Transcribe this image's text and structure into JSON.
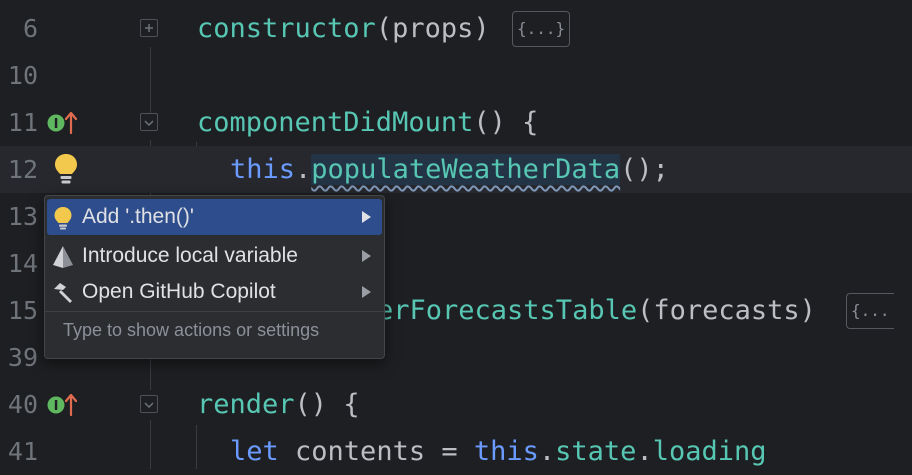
{
  "editor": {
    "lines": [
      {
        "num": "6"
      },
      {
        "num": "10"
      },
      {
        "num": "11"
      },
      {
        "num": "12"
      },
      {
        "num": "13"
      },
      {
        "num": "14"
      },
      {
        "num": "15"
      },
      {
        "num": "39"
      },
      {
        "num": "40"
      },
      {
        "num": "41"
      }
    ],
    "code": {
      "l6_fn": "constructor",
      "l6_args": "(props)",
      "l6_fold": "{...}",
      "l11_fn": "componentDidMount",
      "l11_rest": "() {",
      "l12_kw": "this",
      "l12_dot": ".",
      "l12_fn": "populateWeatherData",
      "l12_rest": "();",
      "l15_fn": "erForecastsTable",
      "l15_args": "(forecasts)",
      "l15_fold": "{...",
      "l40_fn": "render",
      "l40_rest": "() {",
      "l41_kw1": "let",
      "l41_mid": " contents = ",
      "l41_kw2": "this",
      "l41_dot": ".",
      "l41_f1": "state",
      "l41_dot2": ".",
      "l41_f2": "loading"
    }
  },
  "popup": {
    "items": [
      {
        "label": "Add '.then()'",
        "icon": "lightbulb-icon",
        "selected": true
      },
      {
        "label": "Introduce local variable",
        "icon": "pyramid-icon",
        "selected": false
      },
      {
        "label": "Open GitHub Copilot",
        "icon": "hammer-icon",
        "selected": false
      }
    ],
    "hint": "Type to show actions or settings"
  },
  "colors": {
    "background": "#1e1f22",
    "keyword": "#6b9bff",
    "function": "#57c7b4",
    "selection": "#2e4d8c",
    "bulb": "#f2c94c",
    "implements": "#5fb85f",
    "override_arrow": "#e06c4f"
  }
}
